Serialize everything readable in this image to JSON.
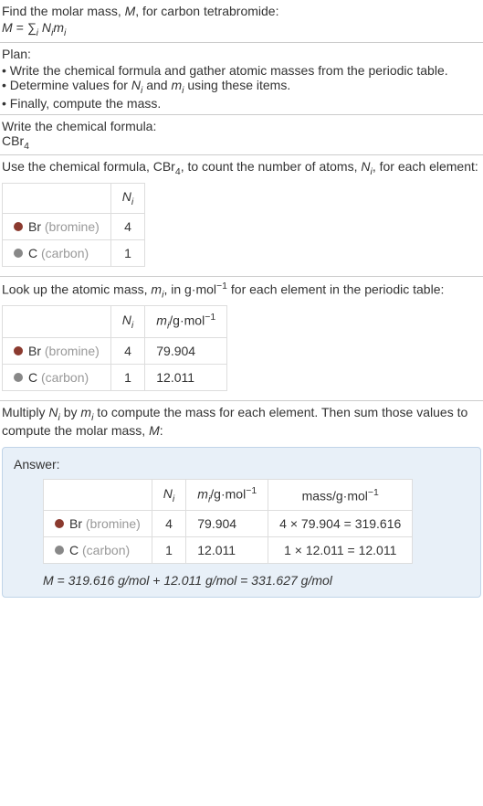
{
  "intro": {
    "line1": "Find the molar mass, M, for carbon tetrabromide:",
    "formula": "M = ∑",
    "formula_sub": "i",
    "formula_rest": " N",
    "formula_sub2": "i",
    "formula_rest2": "m",
    "formula_sub3": "i"
  },
  "plan": {
    "title": "Plan:",
    "item1": "• Write the chemical formula and gather atomic masses from the periodic table.",
    "item2_a": "• Determine values for ",
    "item2_n": "N",
    "item2_i1": "i",
    "item2_b": " and ",
    "item2_m": "m",
    "item2_i2": "i",
    "item2_c": " using these items.",
    "item3": "• Finally, compute the mass."
  },
  "chemformula": {
    "title": "Write the chemical formula:",
    "formula": "CBr",
    "sub": "4"
  },
  "count": {
    "text_a": "Use the chemical formula, CBr",
    "text_sub": "4",
    "text_b": ", to count the number of atoms, ",
    "text_n": "N",
    "text_i": "i",
    "text_c": ", for each element:",
    "header_n": "N",
    "header_i": "i",
    "br_label": "Br",
    "br_name": "(bromine)",
    "br_count": "4",
    "c_label": "C",
    "c_name": "(carbon)",
    "c_count": "1"
  },
  "atomic": {
    "text_a": "Look up the atomic mass, ",
    "text_m": "m",
    "text_i": "i",
    "text_b": ", in g·mol",
    "text_sup": "−1",
    "text_c": " for each element in the periodic table:",
    "header_n": "N",
    "header_ni": "i",
    "header_m": "m",
    "header_mi": "i",
    "header_unit": "/g·mol",
    "header_sup": "−1",
    "br_label": "Br",
    "br_name": "(bromine)",
    "br_count": "4",
    "br_mass": "79.904",
    "c_label": "C",
    "c_name": "(carbon)",
    "c_count": "1",
    "c_mass": "12.011"
  },
  "multiply": {
    "text_a": "Multiply ",
    "text_n": "N",
    "text_ni": "i",
    "text_b": " by ",
    "text_m": "m",
    "text_mi": "i",
    "text_c": " to compute the mass for each element. Then sum those values to compute the molar mass, ",
    "text_M": "M",
    "text_d": ":"
  },
  "answer": {
    "label": "Answer:",
    "header_n": "N",
    "header_ni": "i",
    "header_m": "m",
    "header_mi": "i",
    "header_munit": "/g·mol",
    "header_msup": "−1",
    "header_mass": "mass/g·mol",
    "header_masssup": "−1",
    "br_label": "Br",
    "br_name": "(bromine)",
    "br_count": "4",
    "br_mass": "79.904",
    "br_calc": "4 × 79.904 = 319.616",
    "c_label": "C",
    "c_name": "(carbon)",
    "c_count": "1",
    "c_mass": "12.011",
    "c_calc": "1 × 12.011 = 12.011",
    "final": "M = 319.616 g/mol + 12.011 g/mol = 331.627 g/mol"
  }
}
